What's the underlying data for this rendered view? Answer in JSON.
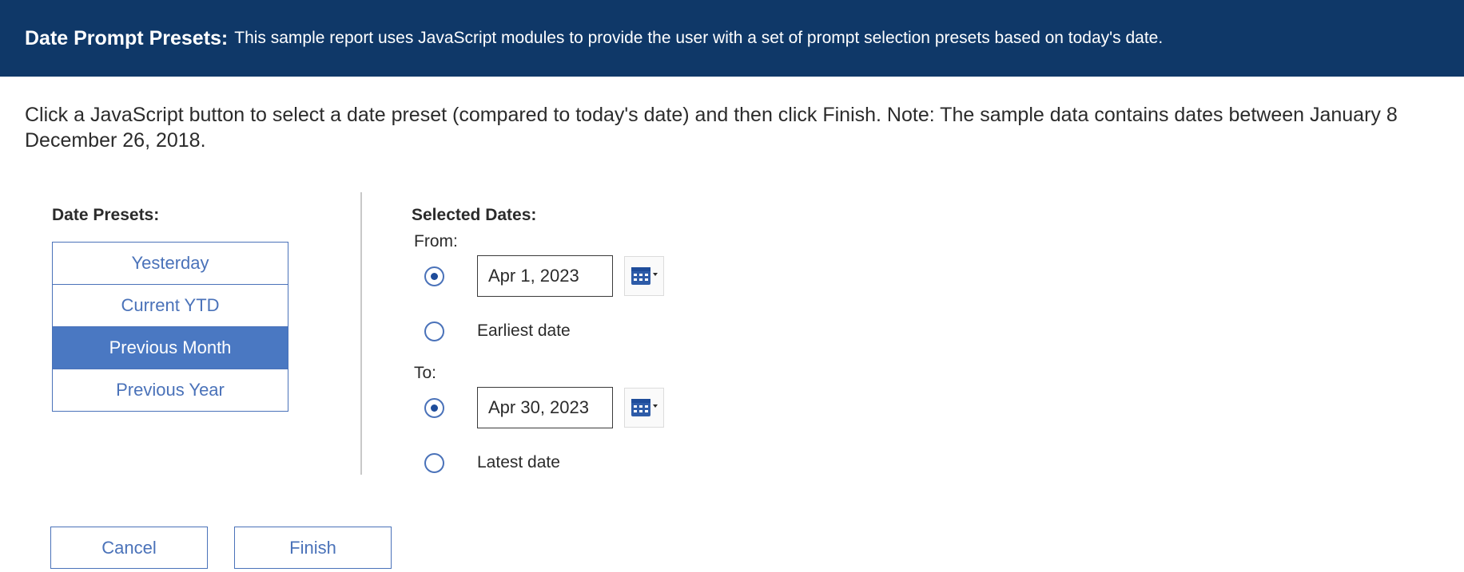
{
  "banner": {
    "title": "Date Prompt Presets:",
    "description": "This sample report uses JavaScript modules to provide the user with a set of prompt selection presets based on today's date."
  },
  "intro": {
    "line1": "Click a JavaScript button to select a date preset (compared to today's date) and then click Finish. Note: The sample data contains dates between January 8",
    "line2": "December 26, 2018."
  },
  "presets": {
    "label": "Date Presets:",
    "items": [
      {
        "label": "Yesterday",
        "selected": false
      },
      {
        "label": "Current YTD",
        "selected": false
      },
      {
        "label": "Previous Month",
        "selected": true
      },
      {
        "label": "Previous Year",
        "selected": false
      }
    ]
  },
  "selected_dates": {
    "label": "Selected Dates:",
    "from": {
      "label": "From:",
      "date_value": "Apr 1, 2023",
      "date_selected": true,
      "alt_option_label": "Earliest date",
      "alt_option_selected": false
    },
    "to": {
      "label": "To:",
      "date_value": "Apr 30, 2023",
      "date_selected": true,
      "alt_option_label": "Latest date",
      "alt_option_selected": false
    }
  },
  "actions": {
    "cancel_label": "Cancel",
    "finish_label": "Finish"
  },
  "colors": {
    "banner_bg": "#0f3868",
    "accent": "#4a72b9",
    "selected_bg": "#4a78c2"
  },
  "icons": {
    "calendar": "calendar-dropdown-icon"
  }
}
